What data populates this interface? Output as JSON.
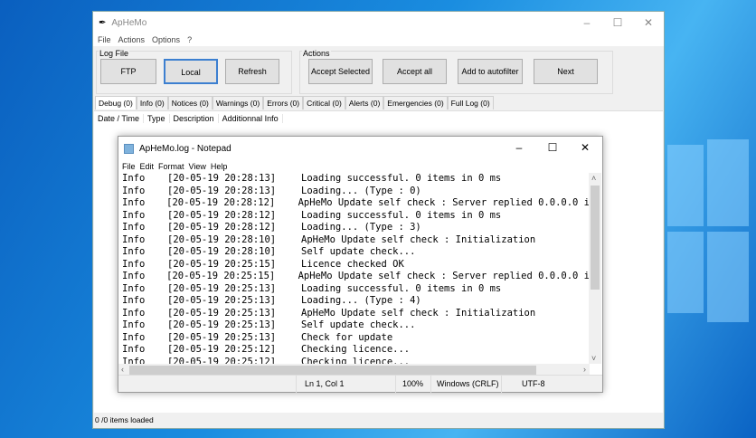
{
  "app": {
    "title": "ApHeMo",
    "menu": [
      "File",
      "Actions",
      "Options",
      "?"
    ],
    "logfile_group": "Log File",
    "actions_group": "Actions",
    "buttons": {
      "ftp": "FTP",
      "local": "Local",
      "refresh": "Refresh",
      "accept_selected": "Accept Selected",
      "accept_all": "Accept all",
      "add_autofilter": "Add to autofilter",
      "next": "Next"
    },
    "tabs": [
      "Debug (0)",
      "Info (0)",
      "Notices (0)",
      "Warnings (0)",
      "Errors (0)",
      "Critical (0)",
      "Alerts (0)",
      "Emergencies (0)",
      "Full Log (0)"
    ],
    "columns": [
      "Date / Time",
      "Type",
      "Description",
      "Additionnal Info"
    ],
    "status": "0 /0 items loaded"
  },
  "notepad": {
    "title": "ApHeMo.log - Notepad",
    "menu": [
      "File",
      "Edit",
      "Format",
      "View",
      "Help"
    ],
    "rows": [
      [
        "Info",
        "[20-05-19 20:28:13]",
        "Loading successful. 0 items in 0 ms"
      ],
      [
        "Info",
        "[20-05-19 20:28:13]",
        "Loading... (Type : 0)"
      ],
      [
        "Info",
        "[20-05-19 20:28:12]",
        "ApHeMo Update self check : Server replied 0.0.0.0 i"
      ],
      [
        "Info",
        "[20-05-19 20:28:12]",
        "Loading successful. 0 items in 0 ms"
      ],
      [
        "Info",
        "[20-05-19 20:28:12]",
        "Loading... (Type : 3)"
      ],
      [
        "Info",
        "[20-05-19 20:28:10]",
        "ApHeMo Update self check : Initialization"
      ],
      [
        "Info",
        "[20-05-19 20:28:10]",
        "Self update check..."
      ],
      [
        "Info",
        "[20-05-19 20:25:15]",
        "Licence checked OK"
      ],
      [
        "Info",
        "[20-05-19 20:25:15]",
        "ApHeMo Update self check : Server replied 0.0.0.0 i"
      ],
      [
        "Info",
        "[20-05-19 20:25:13]",
        "Loading successful. 0 items in 0 ms"
      ],
      [
        "Info",
        "[20-05-19 20:25:13]",
        "Loading... (Type : 4)"
      ],
      [
        "Info",
        "[20-05-19 20:25:13]",
        "ApHeMo Update self check : Initialization"
      ],
      [
        "Info",
        "[20-05-19 20:25:13]",
        "Self update check..."
      ],
      [
        "Info",
        "[20-05-19 20:25:13]",
        "Check for update"
      ],
      [
        "Info",
        "[20-05-19 20:25:12]",
        "Checking licence..."
      ],
      [
        "Info",
        "[20-05-19 20:25:12]",
        "Checking licence..."
      ]
    ],
    "status": {
      "position": "Ln 1, Col 1",
      "zoom": "100%",
      "line_ending": "Windows (CRLF)",
      "encoding": "UTF-8"
    }
  }
}
